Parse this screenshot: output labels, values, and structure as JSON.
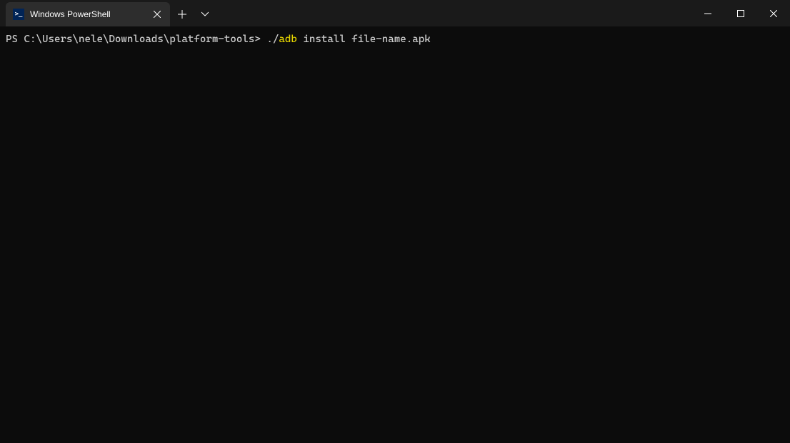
{
  "titlebar": {
    "tab": {
      "title": "Windows PowerShell"
    }
  },
  "terminal": {
    "prompt": "PS C:\\Users\\nele\\Downloads\\platform-tools> ",
    "cmd_prefix": "./",
    "cmd_highlight": "adb",
    "cmd_suffix": " install file-name.apk"
  }
}
